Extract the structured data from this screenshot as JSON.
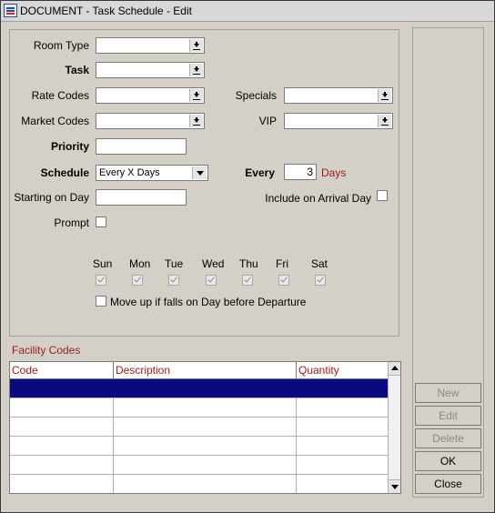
{
  "window": {
    "title": "DOCUMENT - Task Schedule - Edit",
    "icon": "document-app-icon"
  },
  "form": {
    "room_type_label": "Room Type",
    "task_label": "Task",
    "rate_codes_label": "Rate Codes",
    "market_codes_label": "Market Codes",
    "priority_label": "Priority",
    "schedule_label": "Schedule",
    "schedule_value": "Every X Days",
    "starting_on_day_label": "Starting on Day",
    "prompt_label": "Prompt",
    "specials_label": "Specials",
    "vip_label": "VIP",
    "every_label": "Every",
    "every_value": "3",
    "days_label": "Days",
    "include_arrival_label": "Include on Arrival Day",
    "weekdays": [
      "Sun",
      "Mon",
      "Tue",
      "Wed",
      "Thu",
      "Fri",
      "Sat"
    ],
    "weekdays_checked": [
      true,
      true,
      true,
      true,
      true,
      true,
      true
    ],
    "move_up_label": "Move up if falls on Day before Departure"
  },
  "facility": {
    "title": "Facility Codes",
    "columns": [
      "Code",
      "Description",
      "Quantity"
    ],
    "rows": [
      [
        "",
        "",
        ""
      ],
      [
        "",
        "",
        ""
      ],
      [
        "",
        "",
        ""
      ],
      [
        "",
        "",
        ""
      ],
      [
        "",
        "",
        ""
      ],
      [
        "",
        "",
        ""
      ]
    ],
    "selected_row": 0
  },
  "buttons": {
    "new": "New",
    "edit": "Edit",
    "delete": "Delete",
    "ok": "OK",
    "close": "Close"
  },
  "colors": {
    "label_red": "#9a1a1a",
    "selection": "#0a0a80",
    "dialog_bg": "#d4d0c8"
  }
}
